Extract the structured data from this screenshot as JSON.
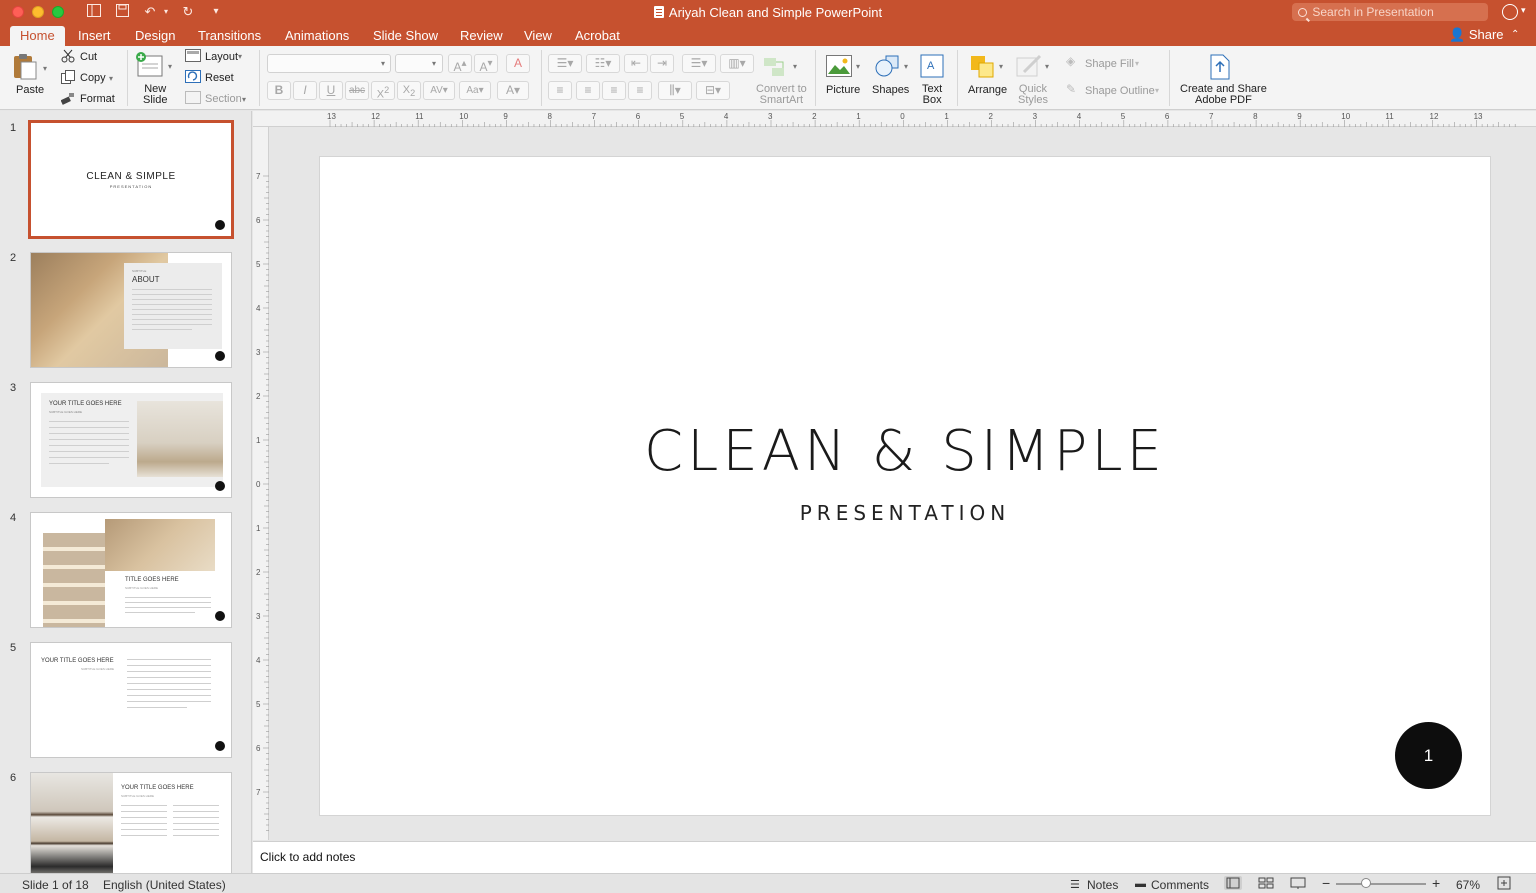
{
  "window": {
    "title": "Ariyah Clean and Simple PowerPoint",
    "search_placeholder": "Search in Presentation"
  },
  "tabs": [
    {
      "label": "Home",
      "active": true
    },
    {
      "label": "Insert"
    },
    {
      "label": "Design"
    },
    {
      "label": "Transitions"
    },
    {
      "label": "Animations"
    },
    {
      "label": "Slide Show"
    },
    {
      "label": "Review"
    },
    {
      "label": "View"
    },
    {
      "label": "Acrobat"
    }
  ],
  "share_label": "Share",
  "ribbon": {
    "paste": "Paste",
    "cut": "Cut",
    "copy": "Copy",
    "format": "Format",
    "new_slide_1": "New",
    "new_slide_2": "Slide",
    "layout": "Layout",
    "reset": "Reset",
    "section": "Section",
    "convert_1": "Convert to",
    "convert_2": "SmartArt",
    "picture": "Picture",
    "shapes": "Shapes",
    "textbox_1": "Text",
    "textbox_2": "Box",
    "arrange": "Arrange",
    "quick_styles_1": "Quick",
    "quick_styles_2": "Styles",
    "shape_fill": "Shape Fill",
    "shape_outline": "Shape Outline",
    "adobe_1": "Create and Share",
    "adobe_2": "Adobe PDF"
  },
  "ruler": {
    "h_ticks": [
      "13",
      "12",
      "11",
      "10",
      "9",
      "8",
      "7",
      "6",
      "5",
      "4",
      "3",
      "2",
      "1",
      "0",
      "1",
      "2",
      "3",
      "4",
      "5",
      "6",
      "7",
      "8",
      "9",
      "10",
      "11",
      "12",
      "13"
    ],
    "v_ticks": [
      "7",
      "6",
      "5",
      "4",
      "3",
      "2",
      "1",
      "0",
      "1",
      "2",
      "3",
      "4",
      "5",
      "6",
      "7"
    ]
  },
  "thumbnails": [
    {
      "number": "1",
      "title": "CLEAN & SIMPLE",
      "subtitle": "PRESENTATION"
    },
    {
      "number": "2",
      "overline": "SUBTITLE",
      "title": "ABOUT"
    },
    {
      "number": "3",
      "title": "YOUR TITLE GOES HERE",
      "subtitle": "SUBTITLE GOES HERE"
    },
    {
      "number": "4",
      "title": "TITLE GOES HERE",
      "subtitle": "SUBTITLE GOES HERE"
    },
    {
      "number": "5",
      "title": "YOUR TITLE GOES HERE",
      "subtitle": "SUBTITLE GOES HERE"
    },
    {
      "number": "6",
      "title": "YOUR TITLE GOES HERE",
      "subtitle": "SUBTITLE GOES HERE"
    }
  ],
  "slide": {
    "title": "CLEAN & SIMPLE",
    "subtitle": "PRESENTATION",
    "page_number": "1"
  },
  "notes_placeholder": "Click to add notes",
  "status": {
    "slide_info": "Slide 1 of 18",
    "language": "English (United States)",
    "notes": "Notes",
    "comments": "Comments",
    "zoom": "67%"
  },
  "colors": {
    "brand": "#c6512f",
    "ribbon_bg": "#f4f4f4",
    "slide_bg": "#ffffff",
    "accent_dark": "#0d0d0d"
  }
}
